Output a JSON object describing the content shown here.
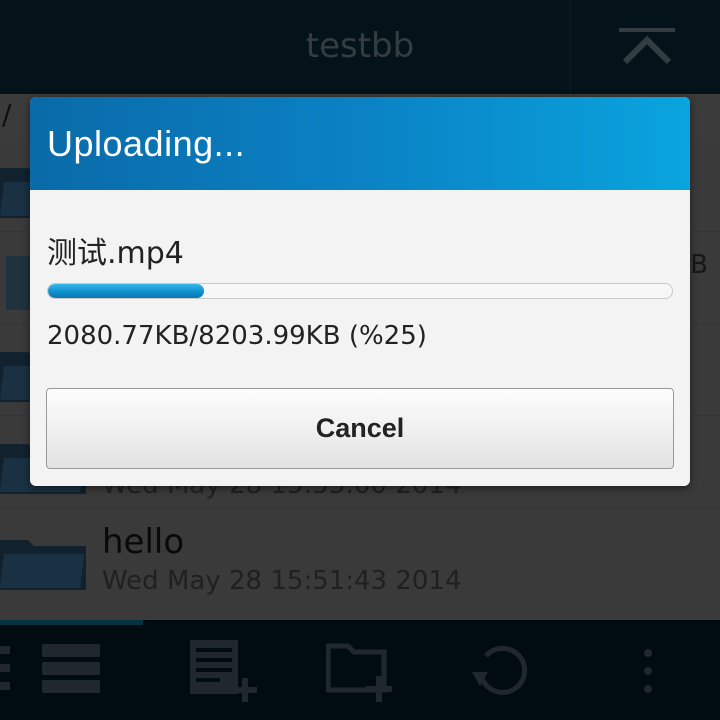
{
  "titlebar": {
    "title": "testbb",
    "up_icon": "chevron-up-icon"
  },
  "pathline": {
    "path": "/"
  },
  "filelist": {
    "rows": [
      {
        "name": "",
        "date": "",
        "icon": "folder-icon",
        "side": ""
      },
      {
        "name": "",
        "date": "",
        "icon": "file-icon",
        "side": "B"
      },
      {
        "name": "",
        "date": "",
        "icon": "folder-icon",
        "side": ""
      },
      {
        "name": "",
        "date": "Wed May 28 15:53:00 2014",
        "icon": "folder-icon",
        "side": ""
      },
      {
        "name": "hello",
        "date": "Wed May 28 15:51:43 2014",
        "icon": "folder-icon",
        "side": ""
      }
    ]
  },
  "dialog": {
    "title": "Uploading...",
    "filename": "测试.mp4",
    "progress_percent": 25,
    "progress_text": "2080.77KB/8203.99KB (%25)",
    "cancel_label": "Cancel"
  },
  "actionbar": {
    "items": [
      {
        "icon": "list-view-icon",
        "active": true
      },
      {
        "icon": "new-file-icon"
      },
      {
        "icon": "new-folder-icon"
      },
      {
        "icon": "refresh-icon"
      },
      {
        "icon": "overflow-menu-icon"
      }
    ]
  },
  "colors": {
    "accent": "#0a82c4",
    "titlebar_bg": "#06232f",
    "actionbar_bg": "#02171f"
  }
}
